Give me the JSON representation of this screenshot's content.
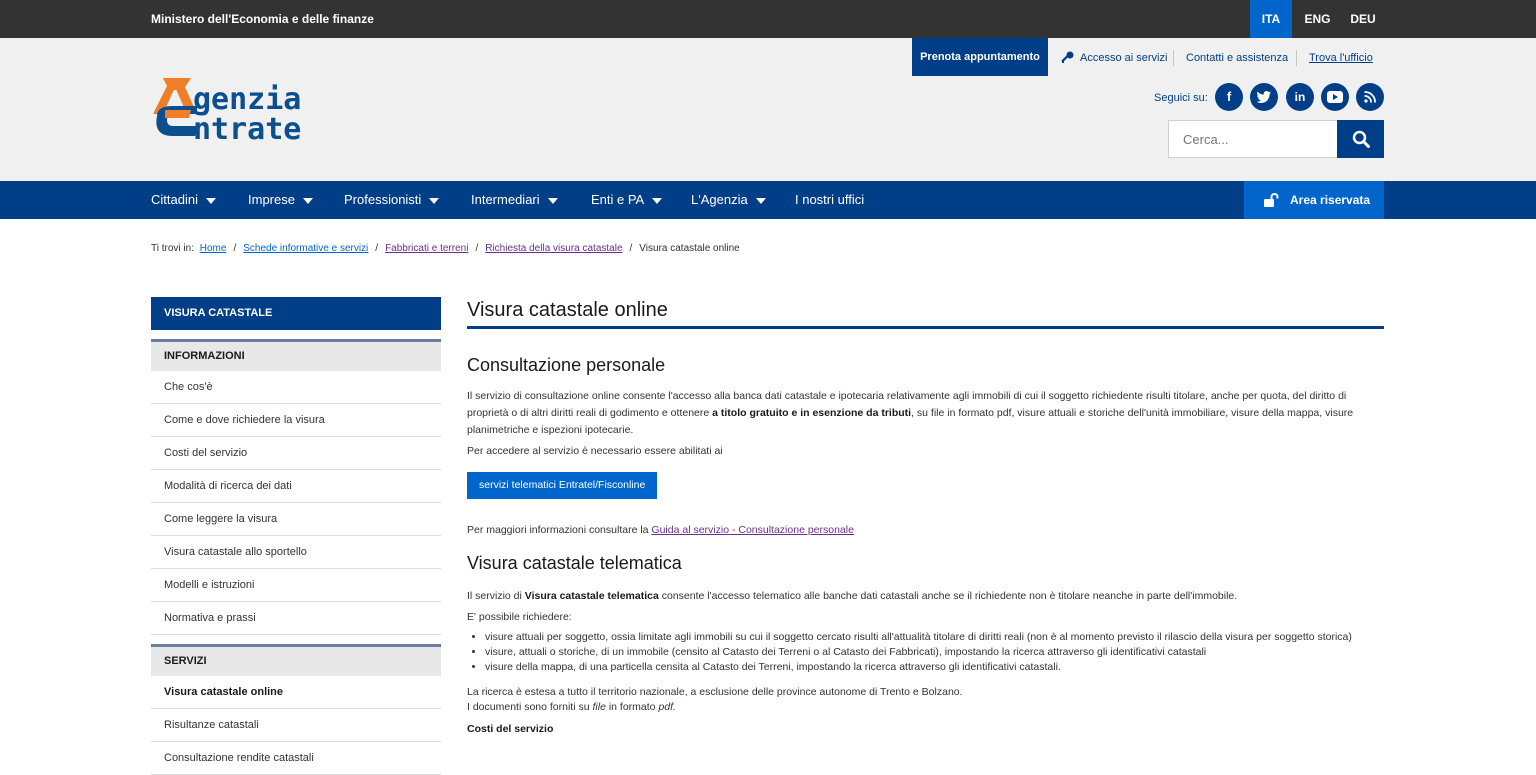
{
  "topbar": {
    "ministry": "Ministero dell'Economia e delle finanze",
    "languages": [
      {
        "label": "ITA",
        "active": true
      },
      {
        "label": "ENG",
        "active": false
      },
      {
        "label": "DEU",
        "active": false
      }
    ]
  },
  "header": {
    "logo_line1": "genzia",
    "logo_line2": "ntrate",
    "utility": {
      "prenota": "Prenota appuntamento",
      "accesso": "Accesso ai servizi",
      "contatti": "Contatti e assistenza",
      "trova": "Trova l'ufficio"
    },
    "seguici": "Seguici su:",
    "social_icons": [
      "facebook-icon",
      "twitter-icon",
      "linkedin-icon",
      "youtube-icon",
      "rss-icon"
    ],
    "search_placeholder": "Cerca..."
  },
  "nav": {
    "items": [
      {
        "label": "Cittadini"
      },
      {
        "label": "Imprese"
      },
      {
        "label": "Professionisti"
      },
      {
        "label": "Intermediari"
      },
      {
        "label": "Enti e PA"
      },
      {
        "label": "L'Agenzia"
      },
      {
        "label": "I nostri uffici"
      }
    ],
    "area_riservata": "Area riservata"
  },
  "breadcrumb": {
    "prefix": "Ti trovi in:",
    "items": [
      "Home",
      "Schede informative e servizi",
      "Fabbricati e terreni",
      "Richiesta della visura catastale"
    ],
    "current": "Visura catastale online"
  },
  "sidebar": {
    "title": "VISURA CATASTALE",
    "section_info": "INFORMAZIONI",
    "info_items": [
      "Che cos'è",
      "Come e dove richiedere la visura",
      "Costi del servizio",
      "Modalità di ricerca dei dati",
      "Come leggere la visura",
      "Visura catastale allo sportello",
      "Modelli e istruzioni",
      "Normativa e prassi"
    ],
    "section_servizi": "SERVIZI",
    "servizi_items": [
      "Visura catastale online",
      "Risultanze catastali",
      "Consultazione rendite catastali"
    ]
  },
  "main": {
    "title": "Visura catastale online",
    "h2_personale": "Consultazione personale",
    "p1_a": "Il servizio di consultazione online consente l'accesso alla banca dati catastale e ipotecaria relativamente agli immobili di cui il soggetto richiedente risulti titolare, anche per quota, del diritto di proprietà o di altri diritti reali di godimento e ottenere ",
    "p1_bold": "a titolo gratuito e in esenzione da tributi",
    "p1_b": ", su file in formato pdf, visure attuali e storiche dell'unità immobiliare, visure della mappa, visure planimetriche e ispezioni ipotecarie.",
    "p2": "Per accedere al servizio è necessario essere abilitati ai",
    "btn_servizi": "servizi telematici Entratel/Fisconline",
    "p3_prefix": "Per maggiori informazioni consultare la ",
    "p3_link": "Guida al servizio - Consultazione personale",
    "h2_telematica": "Visura catastale telematica",
    "p4_a": "Il servizio di ",
    "p4_bold": "Visura catastale telematica",
    "p4_b": " consente l'accesso telematico alle banche dati catastali anche se il richiedente non è titolare neanche in parte dell'immobile.",
    "p5": "E' possibile richiedere:",
    "bullets": [
      "visure attuali per soggetto, ossia limitate agli immobili su cui il soggetto cercato risulti all'attualità titolare di diritti reali (non è al momento previsto il rilascio della visura per soggetto storica)",
      "visure, attuali o storiche, di un immobile (censito al Catasto dei Terreni o al Catasto dei Fabbricati), impostando la ricerca attraverso gli identificativi catastali",
      "visure della mappa, di una particella censita al Catasto dei Terreni, impostando la ricerca attraverso gli identificativi catastali."
    ],
    "p6": "La ricerca è estesa a tutto il territorio nazionale, a esclusione delle province autonome di Trento e Bolzano.",
    "p7_a": "I documenti sono forniti su ",
    "p7_i1": "file",
    "p7_b": " in formato ",
    "p7_i2": "pdf.",
    "costi_heading": "Costi del servizio"
  },
  "colors": {
    "primary": "#003f87",
    "accent": "#0066cc",
    "topbar": "#333333",
    "header_bg": "#f0f0f0",
    "visited_link": "#6b2f8f"
  }
}
